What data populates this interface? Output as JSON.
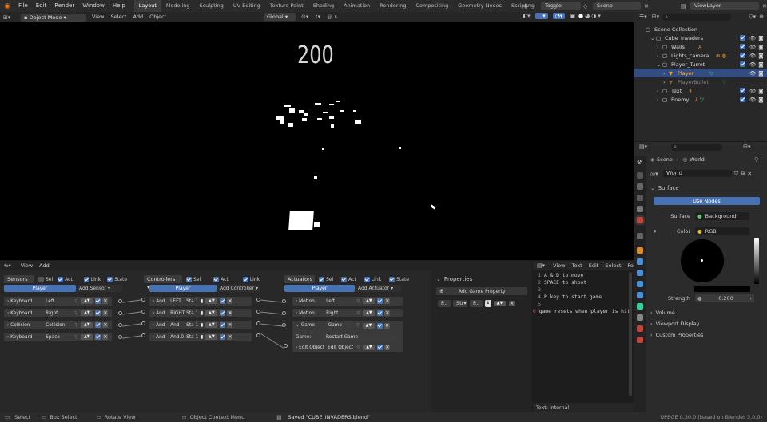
{
  "topbar": {
    "menus": [
      "File",
      "Edit",
      "Render",
      "Window",
      "Help"
    ],
    "workspaces": [
      "Layout",
      "Modeling",
      "Sculpting",
      "UV Editing",
      "Texture Paint",
      "Shading",
      "Animation",
      "Rendering",
      "Compositing",
      "Geometry Nodes",
      "Scripting"
    ],
    "active_workspace": "Layout",
    "plus": "+",
    "toggle_system": "Toggle system",
    "scene": "Scene",
    "view_layer": "ViewLayer"
  },
  "viewport_header": {
    "mode": "Object Mode",
    "menus": [
      "View",
      "Select",
      "Add",
      "Object"
    ],
    "orientation": "Global"
  },
  "viewport": {
    "score": "200"
  },
  "logic_editor": {
    "menus": [
      "View",
      "Add"
    ],
    "sensors": {
      "title": "Sensors",
      "flags": [
        "Sel",
        "Act",
        "Link",
        "State"
      ],
      "object": "Player",
      "add": "Add Sensor",
      "items": [
        {
          "type": "Keyboard",
          "name": "Left"
        },
        {
          "type": "Keyboard",
          "name": "Right"
        },
        {
          "type": "Collision",
          "name": "Collision"
        },
        {
          "type": "Keyboard",
          "name": "Space"
        }
      ]
    },
    "controllers": {
      "title": "Controllers",
      "flags": [
        "Sel",
        "Act",
        "Link"
      ],
      "object": "Player",
      "add": "Add Controller",
      "items": [
        {
          "type": "And",
          "name": "LEFT",
          "state": "Sta 1"
        },
        {
          "type": "And",
          "name": "RIGHT",
          "state": "Sta 1"
        },
        {
          "type": "And",
          "name": "And",
          "state": "Sta 1"
        },
        {
          "type": "And",
          "name": "And.0",
          "state": "Sta 1"
        }
      ]
    },
    "actuators": {
      "title": "Actuators",
      "flags": [
        "Sel",
        "Act",
        "Link",
        "State"
      ],
      "object": "Player",
      "add": "Add Actuator",
      "items": [
        {
          "type": "Motion",
          "name": "Left"
        },
        {
          "type": "Motion",
          "name": "Right"
        },
        {
          "type": "Game",
          "name": "Game",
          "sub_label": "Game:",
          "sub_value": "Restart Game"
        },
        {
          "type": "Edit Object",
          "name": "Edit Object"
        }
      ]
    }
  },
  "game_properties": {
    "title": "Properties",
    "add": "Add Game Property",
    "row": {
      "name": "P..",
      "type": "Str",
      "value": "P.."
    }
  },
  "text_editor": {
    "menus": [
      "View",
      "Text",
      "Edit",
      "Select",
      "Form"
    ],
    "lines": [
      {
        "n": "1",
        "text": "A & D to move"
      },
      {
        "n": "2",
        "text": "SPACE to shoot"
      },
      {
        "n": "3",
        "text": ""
      },
      {
        "n": "4",
        "text": "P key to start game"
      },
      {
        "n": "5",
        "text": ""
      },
      {
        "n": "6",
        "text": "game resets when player is hit"
      }
    ],
    "footer": "Text: Internal"
  },
  "outliner": {
    "root": "Scene Collection",
    "items": [
      {
        "label": "Cube_Invaders",
        "indent": 1
      },
      {
        "label": "Walls",
        "indent": 2
      },
      {
        "label": "Lights_camera",
        "indent": 2
      },
      {
        "label": "Player_Turret",
        "indent": 2
      },
      {
        "label": "Player",
        "indent": 3,
        "selected": true
      },
      {
        "label": "PlayerBullet",
        "indent": 3,
        "dim": true
      },
      {
        "label": "Text",
        "indent": 2
      },
      {
        "label": "Enemy",
        "indent": 2
      }
    ]
  },
  "properties": {
    "breadcrumb": [
      "Scene",
      "World"
    ],
    "world_name": "World",
    "surface": "Surface",
    "use_nodes": "Use Nodes",
    "surface_label": "Surface",
    "surface_value": "Background",
    "color_label": "Color",
    "color_value": "RGB",
    "strength_label": "Strength",
    "strength_value": "0.200",
    "panels": [
      "Volume",
      "Viewport Display",
      "Custom Properties"
    ]
  },
  "status": {
    "select": "Select",
    "box_select": "Box Select",
    "rotate": "Rotate View",
    "context": "Object Context Menu",
    "saved": "Saved \"CUBE_INVADERS.blend\"",
    "version": "UPBGE 0.30.0 (based on Blender 3.0.0)"
  },
  "colors": {
    "accent": "#4772b3",
    "selected_row": "#334d80",
    "background": "#1d1d1d"
  }
}
